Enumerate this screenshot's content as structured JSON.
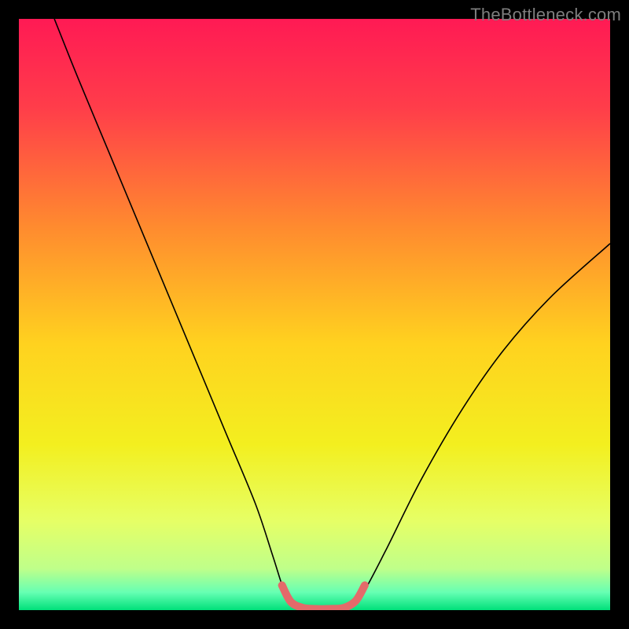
{
  "watermark": "TheBottleneck.com",
  "chart_data": {
    "type": "line",
    "title": "",
    "xlabel": "",
    "ylabel": "",
    "xlim": [
      0,
      100
    ],
    "ylim": [
      0,
      100
    ],
    "background_gradient": {
      "stops": [
        {
          "offset": 0.0,
          "color": "#ff1a54"
        },
        {
          "offset": 0.15,
          "color": "#ff3d4a"
        },
        {
          "offset": 0.35,
          "color": "#ff8a2f"
        },
        {
          "offset": 0.55,
          "color": "#ffd21f"
        },
        {
          "offset": 0.72,
          "color": "#f3ef1f"
        },
        {
          "offset": 0.85,
          "color": "#e6ff66"
        },
        {
          "offset": 0.93,
          "color": "#bfff8a"
        },
        {
          "offset": 0.97,
          "color": "#66ffb3"
        },
        {
          "offset": 1.0,
          "color": "#00e07a"
        }
      ]
    },
    "series": [
      {
        "name": "bottleneck-curve",
        "color": "#000000",
        "width": 1.6,
        "points": [
          {
            "x": 6,
            "y": 100
          },
          {
            "x": 10,
            "y": 90
          },
          {
            "x": 15,
            "y": 78
          },
          {
            "x": 20,
            "y": 66
          },
          {
            "x": 25,
            "y": 54
          },
          {
            "x": 30,
            "y": 42
          },
          {
            "x": 35,
            "y": 30
          },
          {
            "x": 40,
            "y": 18
          },
          {
            "x": 43,
            "y": 9
          },
          {
            "x": 45,
            "y": 3
          },
          {
            "x": 47,
            "y": 0.5
          },
          {
            "x": 50,
            "y": 0
          },
          {
            "x": 53,
            "y": 0
          },
          {
            "x": 56,
            "y": 0.5
          },
          {
            "x": 58,
            "y": 2.5
          },
          {
            "x": 62,
            "y": 10
          },
          {
            "x": 68,
            "y": 22
          },
          {
            "x": 75,
            "y": 34
          },
          {
            "x": 82,
            "y": 44
          },
          {
            "x": 90,
            "y": 53
          },
          {
            "x": 100,
            "y": 62
          }
        ]
      },
      {
        "name": "optimal-range-marker",
        "color": "#e36a6a",
        "width": 10,
        "linecap": "round",
        "points": [
          {
            "x": 44.5,
            "y": 4.2
          },
          {
            "x": 46.0,
            "y": 1.4
          },
          {
            "x": 48.0,
            "y": 0.4
          },
          {
            "x": 50.0,
            "y": 0.2
          },
          {
            "x": 52.5,
            "y": 0.2
          },
          {
            "x": 55.0,
            "y": 0.4
          },
          {
            "x": 57.0,
            "y": 1.6
          },
          {
            "x": 58.5,
            "y": 4.2
          }
        ]
      }
    ]
  }
}
